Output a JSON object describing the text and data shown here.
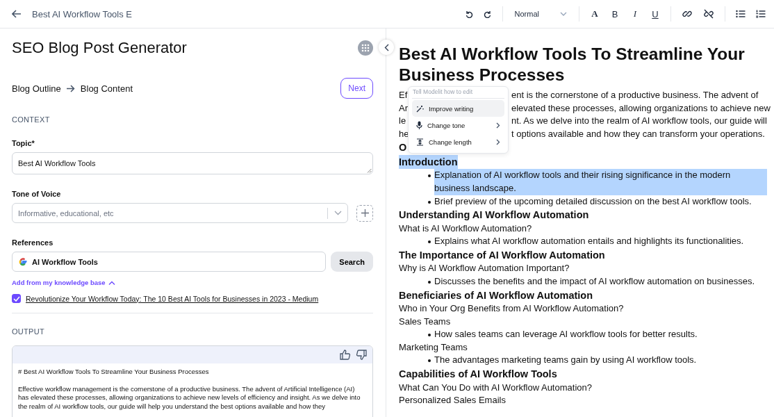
{
  "header": {
    "title": "Best AI Workflow Tools E"
  },
  "toolbar": {
    "style_select": "Normal",
    "buttons": [
      {
        "kind": "undo"
      },
      {
        "kind": "redo"
      },
      {
        "kind": "select"
      },
      {
        "kind": "font",
        "glyph": "A"
      },
      {
        "kind": "bold",
        "glyph": "B"
      },
      {
        "kind": "italic",
        "glyph": "I"
      },
      {
        "kind": "underline",
        "glyph": "U"
      },
      {
        "kind": "link"
      },
      {
        "kind": "unlink"
      },
      {
        "kind": "bullets"
      },
      {
        "kind": "numbers"
      }
    ]
  },
  "generator": {
    "title": "SEO Blog Post Generator",
    "steps": [
      "Blog Outline",
      "Blog Content"
    ],
    "next_button": "Next",
    "context_heading": "CONTEXT",
    "topic": {
      "label": "Topic*",
      "value": "Best AI Workflow Tools"
    },
    "tone": {
      "label": "Tone of Voice",
      "placeholder": "Informative, educational, etc"
    },
    "references": {
      "label": "References",
      "value": "AI Workflow Tools",
      "search_button": "Search",
      "knowledge_link": "Add from my knowledge base",
      "items": [
        {
          "title": "Revolutionize Your Workflow Today: The 10 Best AI Tools for Businesses in 2023 - Medium",
          "checked": true
        }
      ]
    },
    "output_heading": "OUTPUT",
    "output_lines": [
      "# Best AI Workflow Tools To Streamline Your Business Processes",
      "Effective workflow management is the cornerstone of a productive business. The advent of Artificial Intelligence (AI) has elevated these processes, allowing organizations to achieve new levels of efficiency and insight. As we delve into the realm of AI workflow tools, our guide will help you understand the best options available and how they"
    ]
  },
  "document": {
    "title": "Best AI Workflow Tools To Streamline Your Business Processes",
    "intro_lines": [
      {
        "left": "Ef",
        "right": "ent is the cornerstone of a productive business. The advent of"
      },
      {
        "left": "Ar",
        "right": "elevated these processes, allowing organizations to achieve new"
      },
      {
        "left": "le",
        "right": "nt. As we delve into the realm of AI workflow tools, our guide will"
      },
      {
        "left": "he",
        "right": "t options available and how they can transform your operations."
      }
    ],
    "blocks": [
      {
        "kind": "h2",
        "text": "O",
        "selected": false
      },
      {
        "kind": "h2",
        "text": "Introduction",
        "selected": true
      },
      {
        "kind": "bullet",
        "text": "Explanation of AI workflow tools and their rising significance in the modern business landscape.",
        "selected": true
      },
      {
        "kind": "bullet",
        "text": "Brief preview of the upcoming detailed discussion on the best AI workflow tools.",
        "selected": false
      },
      {
        "kind": "h2",
        "text": "Understanding AI Workflow Automation",
        "selected": false
      },
      {
        "kind": "p",
        "text": "What is AI Workflow Automation?",
        "selected": false
      },
      {
        "kind": "bullet",
        "text": "Explains what AI workflow automation entails and highlights its functionalities.",
        "selected": false
      },
      {
        "kind": "h2",
        "text": "The Importance of AI Workflow Automation",
        "selected": false
      },
      {
        "kind": "p",
        "text": "Why is AI Workflow Automation Important?",
        "selected": false
      },
      {
        "kind": "bullet",
        "text": "Discusses the benefits and the impact of AI workflow automation on businesses.",
        "selected": false
      },
      {
        "kind": "h2",
        "text": "Beneficiaries of AI Workflow Automation",
        "selected": false
      },
      {
        "kind": "p",
        "text": "Who in Your Org Benefits from AI Workflow Automation?",
        "selected": false
      },
      {
        "kind": "p",
        "text": "Sales Teams",
        "selected": false
      },
      {
        "kind": "bullet",
        "text": "How sales teams can leverage AI workflow tools for better results.",
        "selected": false
      },
      {
        "kind": "p",
        "text": "Marketing Teams",
        "selected": false
      },
      {
        "kind": "bullet",
        "text": "The advantages marketing teams gain by using AI workflow tools.",
        "selected": false
      },
      {
        "kind": "h2",
        "text": "Capabilities of AI Workflow Tools",
        "selected": false
      },
      {
        "kind": "p",
        "text": "What Can You Do with AI Workflow Automation?",
        "selected": false
      },
      {
        "kind": "p",
        "text": "Personalized Sales Emails",
        "selected": false
      }
    ]
  },
  "ai_menu": {
    "prompt": "Tell Modelit how to edit",
    "items": [
      {
        "kind": "wand",
        "label": "Improve writing",
        "selected": true,
        "has_submenu": false
      },
      {
        "kind": "mic",
        "label": "Change tone",
        "selected": false,
        "has_submenu": true
      },
      {
        "kind": "length",
        "label": "Change length",
        "selected": false,
        "has_submenu": true
      }
    ]
  }
}
